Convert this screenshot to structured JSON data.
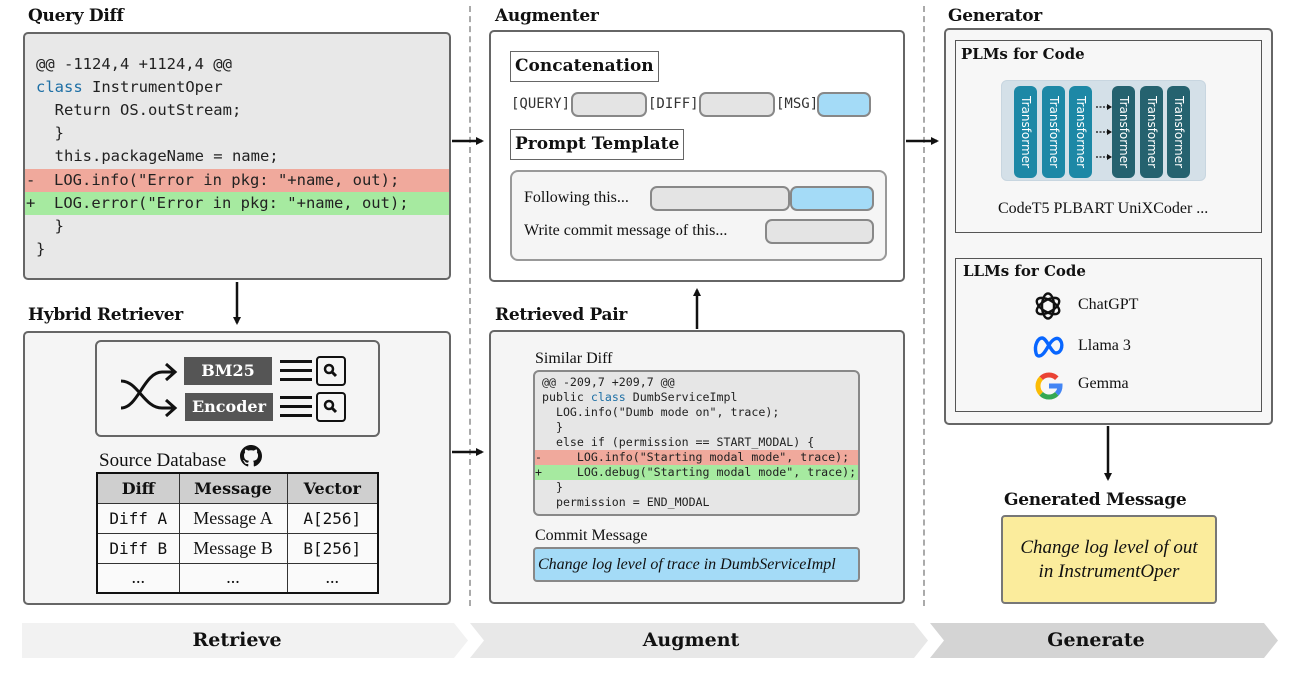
{
  "query_diff": {
    "title": "Query Diff",
    "lines": [
      {
        "type": "ctx",
        "text": "@@ -1124,4 +1124,4 @@"
      },
      {
        "type": "ctx",
        "kw": "class",
        "text": " InstrumentOper"
      },
      {
        "type": "ctx",
        "text": "  Return OS.outStream;"
      },
      {
        "type": "ctx",
        "text": "  }"
      },
      {
        "type": "ctx",
        "text": "  this.packageName = name;"
      },
      {
        "type": "del",
        "text": "-  LOG.info(\"Error in pkg: \"+name, out);"
      },
      {
        "type": "add",
        "text": "+  LOG.error(\"Error in pkg: \"+name, out);"
      },
      {
        "type": "ctx",
        "text": "  }"
      },
      {
        "type": "ctx",
        "text": "}"
      }
    ]
  },
  "hybrid_retriever": {
    "title": "Hybrid Retriever",
    "retrievers": [
      "BM25",
      "Encoder"
    ],
    "source_db_label": "Source Database",
    "table": {
      "headers": [
        "Diff",
        "Message",
        "Vector"
      ],
      "rows": [
        [
          "Diff A",
          "Message A",
          "A[256]"
        ],
        [
          "Diff B",
          "Message B",
          "B[256]"
        ],
        [
          "...",
          "...",
          "..."
        ]
      ]
    }
  },
  "augmenter": {
    "title": "Augmenter",
    "concatenation_title": "Concatenation",
    "tags": [
      "[QUERY]",
      "[DIFF]",
      "[MSG]"
    ],
    "prompt_template_title": "Prompt Template",
    "prompt_lines": [
      "Following this...",
      "Write commit message of this..."
    ]
  },
  "retrieved_pair": {
    "title": "Retrieved Pair",
    "similar_diff_label": "Similar Diff",
    "similar_diff_lines": [
      {
        "type": "ctx",
        "text": "@@ -209,7 +209,7 @@"
      },
      {
        "type": "ctx",
        "pre": "public ",
        "kw": "class",
        "text": " DumbServiceImpl"
      },
      {
        "type": "ctx",
        "text": "  LOG.info(\"Dumb mode on\", trace);"
      },
      {
        "type": "ctx",
        "text": "  }"
      },
      {
        "type": "ctx",
        "text": "  else if (permission == START_MODAL) {"
      },
      {
        "type": "del",
        "text": "-     LOG.info(\"Starting modal mode\", trace);"
      },
      {
        "type": "add",
        "text": "+     LOG.debug(\"Starting modal mode\", trace);"
      },
      {
        "type": "ctx",
        "text": "  }"
      },
      {
        "type": "ctx",
        "text": "  permission = END_MODAL"
      }
    ],
    "commit_message_label": "Commit Message",
    "commit_message": "Change log level of trace in DumbServiceImpl"
  },
  "generator": {
    "title": "Generator",
    "plms_title": "PLMs for Code",
    "transformer_label": "Transformer",
    "plm_models": "CodeT5 PLBART UniXCoder ...",
    "llms_title": "LLMs for Code",
    "llms": [
      {
        "name": "ChatGPT",
        "icon": "openai-icon"
      },
      {
        "name": "Llama 3",
        "icon": "meta-icon"
      },
      {
        "name": "Gemma",
        "icon": "google-icon"
      }
    ]
  },
  "generated_message": {
    "title": "Generated Message",
    "lines": [
      "Change log level of out",
      "in InstrumentOper"
    ]
  },
  "stages": [
    "Retrieve",
    "Augment",
    "Generate"
  ],
  "colors": {
    "deleted_line": "#f0a99c",
    "added_line": "#a6eaa0",
    "message_slot": "#a4dbf7",
    "generated_message_bg": "#fbec9c",
    "transformer_encoder": "#1d88a6",
    "transformer_decoder": "#25626f"
  }
}
